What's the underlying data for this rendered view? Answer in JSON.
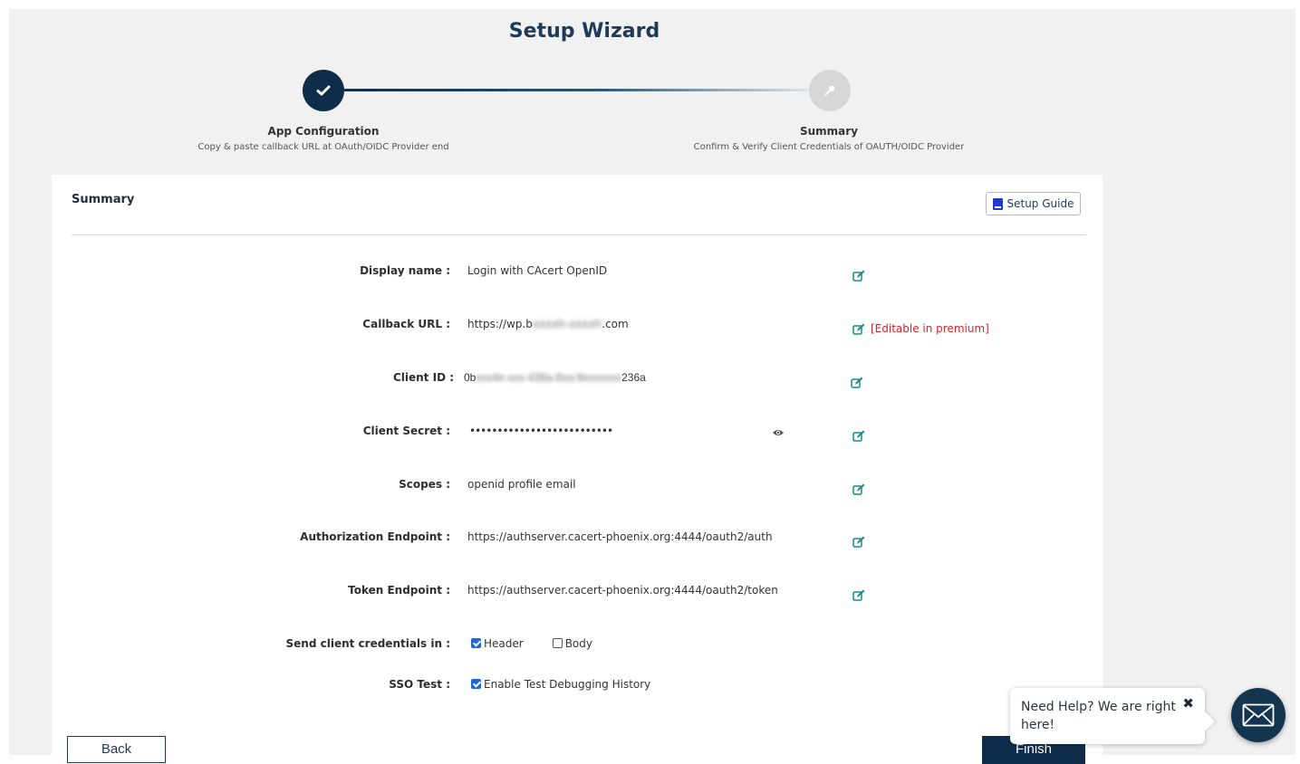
{
  "wizard": {
    "title": "Setup Wizard",
    "steps": [
      {
        "label": "App Configuration",
        "description": "Copy & paste callback URL at OAuth/OIDC Provider end",
        "state": "completed"
      },
      {
        "label": "Summary",
        "description": "Confirm & Verify Client Credentials of OAUTH/OIDC Provider",
        "state": "active"
      }
    ]
  },
  "card": {
    "title": "Summary",
    "setup_guide_label": "Setup Guide"
  },
  "fields": {
    "display_name": {
      "label": "Display name :",
      "value": "Login with CAcert OpenID"
    },
    "callback_url": {
      "label": "Callback URL :",
      "value_prefix": "https://wp.b",
      "value_blurred": "xxxxh-xxxxh",
      "value_suffix": ".com",
      "premium_note": "[Editable in premium]"
    },
    "client_id": {
      "label": "Client ID :",
      "value_prefix": "0b",
      "value_blurred": "xxx4e-xxx-438a-9xa-9exxxxxx",
      "value_suffix": "236a"
    },
    "client_secret": {
      "label": "Client Secret :",
      "value": "••••••••••••••••••••••••••"
    },
    "scopes": {
      "label": "Scopes :",
      "value": "openid profile email"
    },
    "authorization_endpoint": {
      "label": "Authorization Endpoint :",
      "value": "https://authserver.cacert-phoenix.org:4444/oauth2/auth"
    },
    "token_endpoint": {
      "label": "Token Endpoint :",
      "value": "https://authserver.cacert-phoenix.org:4444/oauth2/token"
    },
    "send_credentials": {
      "label": "Send client credentials in :",
      "options": [
        {
          "label": "Header",
          "checked": true
        },
        {
          "label": "Body",
          "checked": false
        }
      ]
    },
    "sso_test": {
      "label": "SSO Test :",
      "option_label": "Enable Test Debugging History",
      "checked": true
    }
  },
  "actions": {
    "back_label": "Back",
    "finish_label": "Finish"
  },
  "help_widget": {
    "text": "Need Help? We are right here!",
    "close_glyph": "✖"
  },
  "colors": {
    "primary_navy": "#0f2d4a",
    "edit_icon_teal": "#1a8a8a",
    "premium_red": "#d9232b",
    "checkbox_blue": "#1d68d6"
  }
}
